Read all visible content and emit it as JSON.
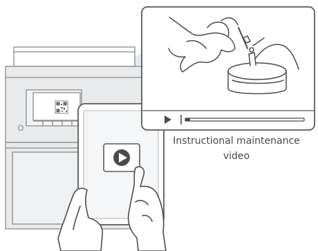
{
  "caption": {
    "line1": "Instructional maintenance",
    "line2": "video"
  },
  "colors": {
    "background": "#ffffff",
    "printer_fill": "#e9eaec",
    "callout_beam": "#dfe8f2",
    "line": "#5a5a5a",
    "light_line": "#9a9a9a"
  },
  "icons": {
    "qr": "qr-code-icon",
    "play_tablet": "play-icon",
    "play_video": "play-triangle-icon"
  },
  "video": {
    "progress": 0.04
  }
}
